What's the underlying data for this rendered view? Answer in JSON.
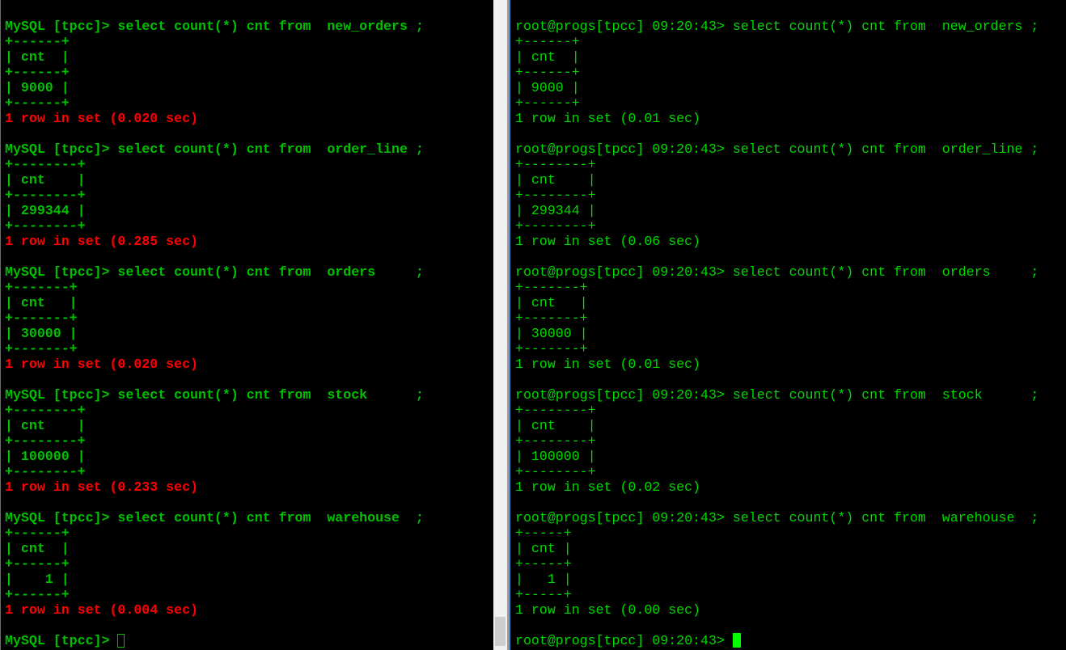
{
  "left_terminal": {
    "prompt": "MySQL [tpcc]> ",
    "colors": {
      "text": "#00c000",
      "result": "#ff0000",
      "background": "#000000"
    },
    "blocks": [
      {
        "command": "select count(*) cnt from  new_orders ;",
        "table": [
          "+------+",
          "| cnt  |",
          "+------+",
          "| 9000 |",
          "+------+"
        ],
        "result": "1 row in set (0.020 sec)"
      },
      {
        "command": "select count(*) cnt from  order_line ;",
        "table": [
          "+--------+",
          "| cnt    |",
          "+--------+",
          "| 299344 |",
          "+--------+"
        ],
        "result": "1 row in set (0.285 sec)"
      },
      {
        "command": "select count(*) cnt from  orders     ;",
        "table": [
          "+-------+",
          "| cnt   |",
          "+-------+",
          "| 30000 |",
          "+-------+"
        ],
        "result": "1 row in set (0.020 sec)"
      },
      {
        "command": "select count(*) cnt from  stock      ;",
        "table": [
          "+--------+",
          "| cnt    |",
          "+--------+",
          "| 100000 |",
          "+--------+"
        ],
        "result": "1 row in set (0.233 sec)"
      },
      {
        "command": "select count(*) cnt from  warehouse  ;",
        "table": [
          "+------+",
          "| cnt  |",
          "+------+",
          "|    1 |",
          "+------+"
        ],
        "result": "1 row in set (0.004 sec)"
      }
    ],
    "final_prompt": "MySQL [tpcc]> ",
    "cursor": "hollow-block"
  },
  "right_terminal": {
    "prompt": "root@progs[tpcc] 09:20:43> ",
    "colors": {
      "text": "#00d800",
      "cursor": "#00ff00",
      "background": "#000000"
    },
    "clipped_top_line": "",
    "blocks": [
      {
        "command": "select count(*) cnt from  new_orders ;",
        "table": [
          "+------+",
          "| cnt  |",
          "+------+",
          "| 9000 |",
          "+------+"
        ],
        "result": "1 row in set (0.01 sec)"
      },
      {
        "command": "select count(*) cnt from  order_line ;",
        "table": [
          "+--------+",
          "| cnt    |",
          "+--------+",
          "| 299344 |",
          "+--------+"
        ],
        "result": "1 row in set (0.06 sec)"
      },
      {
        "command": "select count(*) cnt from  orders     ;",
        "table": [
          "+-------+",
          "| cnt   |",
          "+-------+",
          "| 30000 |",
          "+-------+"
        ],
        "result": "1 row in set (0.01 sec)"
      },
      {
        "command": "select count(*) cnt from  stock      ;",
        "table": [
          "+--------+",
          "| cnt    |",
          "+--------+",
          "| 100000 |",
          "+--------+"
        ],
        "result": "1 row in set (0.02 sec)"
      },
      {
        "command": "select count(*) cnt from  warehouse  ;",
        "table": [
          "+-----+",
          "| cnt |",
          "+-----+",
          "|   1 |",
          "+-----+"
        ],
        "result": "1 row in set (0.00 sec)"
      }
    ],
    "final_prompt": "root@progs[tpcc] 09:20:43> ",
    "cursor": "solid-block"
  },
  "scrollbar": {
    "position_fraction": 1.0
  }
}
